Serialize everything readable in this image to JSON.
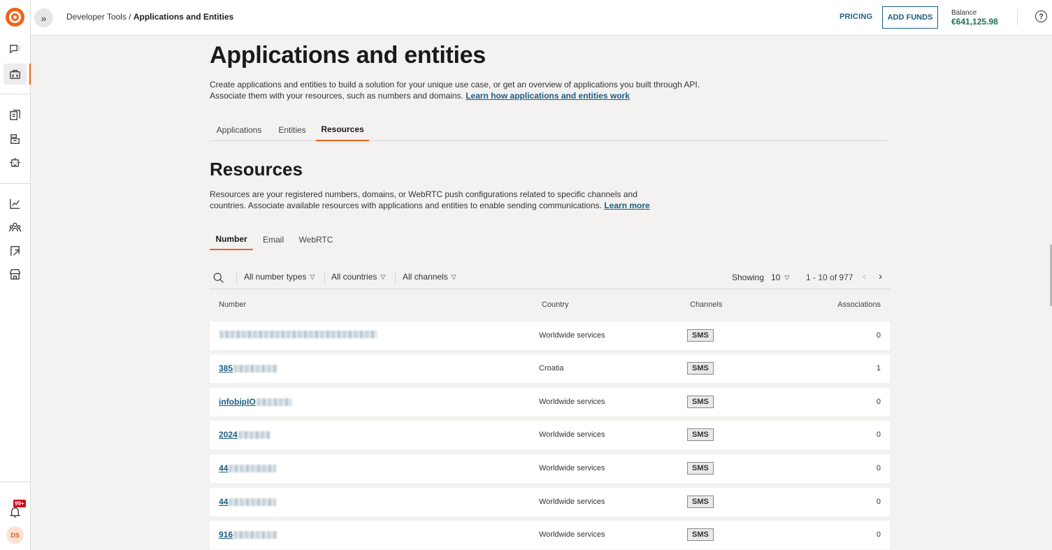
{
  "sidebar": {
    "notification_badge": "99+",
    "avatar_initials": "DS"
  },
  "header": {
    "breadcrumb_parent": "Developer Tools",
    "breadcrumb_separator": " / ",
    "breadcrumb_current": "Applications and Entities",
    "pricing_label": "PRICING",
    "add_funds_label": "ADD FUNDS",
    "balance_label": "Balance",
    "balance_value": "€641,125.98"
  },
  "main": {
    "title": "Applications and entities",
    "description_line1": "Create applications and entities to build a solution for your unique use case, or get an overview of applications you built through API.",
    "description_line2": "Associate them with your resources, such as numbers and domains.",
    "description_link": "Learn how applications and entities work",
    "tabs": [
      {
        "label": "Applications"
      },
      {
        "label": "Entities"
      },
      {
        "label": "Resources"
      }
    ],
    "active_tab": "Resources"
  },
  "resources": {
    "title": "Resources",
    "description_line1": "Resources are your registered numbers, domains, or WebRTC push configurations related to specific channels and",
    "description_line2": "countries. Associate available resources with applications and entities to enable sending communications.",
    "description_link": "Learn more",
    "subtabs": [
      {
        "label": "Number"
      },
      {
        "label": "Email"
      },
      {
        "label": "WebRTC"
      }
    ],
    "active_subtab": "Number"
  },
  "filters": {
    "number_types": "All number types",
    "countries": "All countries",
    "channels": "All channels"
  },
  "pagination": {
    "showing_label": "Showing",
    "page_size": "10",
    "range": "1 - 10 of 977"
  },
  "table": {
    "columns": {
      "number": "Number",
      "country": "Country",
      "channels": "Channels",
      "associations": "Associations"
    },
    "rows": [
      {
        "number_visible": "",
        "country": "Worldwide services",
        "channel": "SMS",
        "associations": "0"
      },
      {
        "number_visible": "385",
        "country": "Croatia",
        "channel": "SMS",
        "associations": "1"
      },
      {
        "number_visible": "infobipIO",
        "country": "Worldwide services",
        "channel": "SMS",
        "associations": "0"
      },
      {
        "number_visible": "2024",
        "country": "Worldwide services",
        "channel": "SMS",
        "associations": "0"
      },
      {
        "number_visible": "44",
        "country": "Worldwide services",
        "channel": "SMS",
        "associations": "0"
      },
      {
        "number_visible": "44",
        "country": "Worldwide services",
        "channel": "SMS",
        "associations": "0"
      },
      {
        "number_visible": "916",
        "country": "Worldwide services",
        "channel": "SMS",
        "associations": "0"
      }
    ]
  },
  "colors": {
    "accent": "#f0631a",
    "link": "#1b5e80",
    "balance": "#1b6e5a",
    "badge": "#d0021b"
  }
}
